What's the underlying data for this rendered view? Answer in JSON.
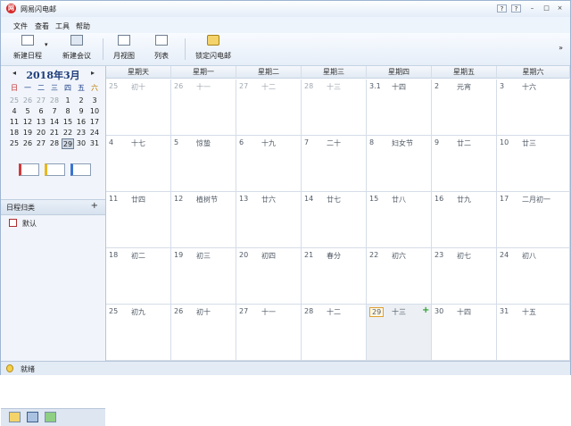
{
  "window": {
    "title": "网易闪电邮",
    "app_icon": "网",
    "controls": [
      "?",
      "?",
      "–",
      "□",
      "×"
    ]
  },
  "menu": [
    "文件",
    "查看",
    "工具",
    "帮助"
  ],
  "toolbar": {
    "new_schedule": "新建日程",
    "new_schedule_dropdown": "▾",
    "new_meeting": "新建会议",
    "month_view": "月视图",
    "list_view": "列表",
    "lock": "锁定闪电邮",
    "overflow": "»"
  },
  "mini_calendar": {
    "prev": "◂",
    "next": "▸",
    "title": "2018年3月",
    "weekdays": [
      "日",
      "一",
      "二",
      "三",
      "四",
      "五",
      "六"
    ],
    "weeks": [
      [
        "25",
        "26",
        "27",
        "28",
        "1",
        "2",
        "3"
      ],
      [
        "4",
        "5",
        "6",
        "7",
        "8",
        "9",
        "10"
      ],
      [
        "11",
        "12",
        "13",
        "14",
        "15",
        "16",
        "17"
      ],
      [
        "18",
        "19",
        "20",
        "21",
        "22",
        "23",
        "24"
      ],
      [
        "25",
        "26",
        "27",
        "28",
        "29",
        "30",
        "31"
      ]
    ],
    "today": "29"
  },
  "category": {
    "title": "日程归类",
    "add": "+",
    "items": [
      {
        "label": "默认"
      }
    ]
  },
  "calendar": {
    "weekdays": [
      "星期天",
      "星期一",
      "星期二",
      "星期三",
      "星期四",
      "星期五",
      "星期六"
    ],
    "weeks": [
      [
        [
          "25",
          "初十"
        ],
        [
          "26",
          "十一"
        ],
        [
          "27",
          "十二"
        ],
        [
          "28",
          "十三"
        ],
        [
          "3.1",
          "十四"
        ],
        [
          "2",
          "元宵"
        ],
        [
          "3",
          "十六"
        ]
      ],
      [
        [
          "4",
          "十七"
        ],
        [
          "5",
          "惊蛰"
        ],
        [
          "6",
          "十九"
        ],
        [
          "7",
          "二十"
        ],
        [
          "8",
          "妇女节"
        ],
        [
          "9",
          "廿二"
        ],
        [
          "10",
          "廿三"
        ]
      ],
      [
        [
          "11",
          "廿四"
        ],
        [
          "12",
          "植树节"
        ],
        [
          "13",
          "廿六"
        ],
        [
          "14",
          "廿七"
        ],
        [
          "15",
          "廿八"
        ],
        [
          "16",
          "廿九"
        ],
        [
          "17",
          "二月初一"
        ]
      ],
      [
        [
          "18",
          "初二"
        ],
        [
          "19",
          "初三"
        ],
        [
          "20",
          "初四"
        ],
        [
          "21",
          "春分"
        ],
        [
          "22",
          "初六"
        ],
        [
          "23",
          "初七"
        ],
        [
          "24",
          "初八"
        ]
      ],
      [
        [
          "25",
          "初九"
        ],
        [
          "26",
          "初十"
        ],
        [
          "27",
          "十一"
        ],
        [
          "28",
          "十二"
        ],
        [
          "29",
          "十三"
        ],
        [
          "30",
          "十四"
        ],
        [
          "31",
          "十五"
        ]
      ]
    ],
    "add_event": "+"
  },
  "status": {
    "text": "就绪"
  }
}
